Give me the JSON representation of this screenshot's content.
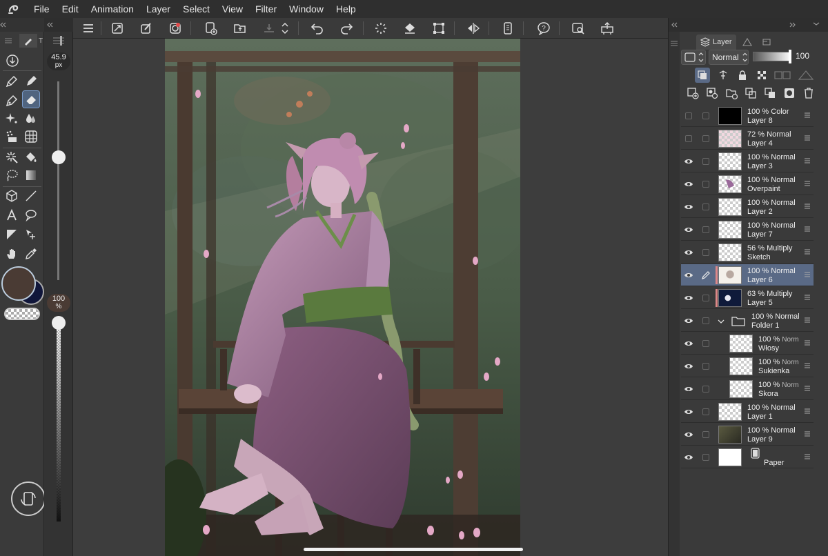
{
  "menu": [
    "File",
    "Edit",
    "Animation",
    "Layer",
    "Select",
    "View",
    "Filter",
    "Window",
    "Help"
  ],
  "brush": {
    "size_value": "45.9",
    "size_unit": "px",
    "opacity_value": "100",
    "opacity_unit": "%"
  },
  "colors": {
    "main": "#4a3b34",
    "sub": "#10163a",
    "accent": "#50647f"
  },
  "icons": {
    "app": "clip-studio-logo",
    "tools": [
      "save-icon",
      "pen-icon",
      "pencil-icon",
      "eraser-icon",
      "sparkle-icon",
      "blend-drop-icon",
      "fill-dots-icon",
      "grid-icon",
      "magic-wand-icon",
      "fill-bucket-icon",
      "lasso-icon",
      "gradient-icon",
      "3d-cube-icon",
      "line-icon",
      "text-icon",
      "speech-balloon-icon",
      "frame-ruler-icon",
      "object-select-icon",
      "hand-icon",
      "eyedropper-icon"
    ],
    "toolbar": [
      "hamburger-icon",
      "canvas-resize-icon",
      "brush-settings-icon",
      "color-wheel-icon",
      "new-file-icon",
      "open-folder-icon",
      "save-cloud-icon",
      "updown-icon",
      "undo-icon",
      "redo-icon",
      "loading-icon",
      "fill-icon",
      "transform-icon",
      "flip-icon",
      "smartphone-icon",
      "help-icon",
      "search-window-icon",
      "export-icon"
    ]
  },
  "layers_panel": {
    "tab_label": "Layer",
    "blend_mode": "Normal",
    "opacity": "100",
    "layers": [
      {
        "opacity": "100 %",
        "mode": "Color",
        "name": "Layer 8",
        "visible": false,
        "thumb": "black"
      },
      {
        "opacity": "72 %",
        "mode": "Normal",
        "name": "Layer 4",
        "visible": false,
        "thumb": "pinkish"
      },
      {
        "opacity": "100 %",
        "mode": "Normal",
        "name": "Layer 3",
        "visible": true,
        "thumb": "checker"
      },
      {
        "opacity": "100 %",
        "mode": "Normal",
        "name": "Overpaint",
        "visible": true,
        "thumb": "figure"
      },
      {
        "opacity": "100 %",
        "mode": "Normal",
        "name": "Layer 2",
        "visible": true,
        "thumb": "checker"
      },
      {
        "opacity": "100 %",
        "mode": "Normal",
        "name": "Layer 7",
        "visible": true,
        "thumb": "checker"
      },
      {
        "opacity": "56 %",
        "mode": "Multiply",
        "name": "Sketch",
        "visible": true,
        "thumb": "checker"
      },
      {
        "opacity": "100 %",
        "mode": "Normal",
        "name": "Layer 6",
        "visible": true,
        "thumb": "light-figure",
        "active": true
      },
      {
        "opacity": "63 %",
        "mode": "Multiply",
        "name": "Layer 5",
        "visible": true,
        "thumb": "navy"
      },
      {
        "opacity": "100 %",
        "mode": "Normal",
        "name": "Folder 1",
        "visible": true,
        "folder": true
      },
      {
        "opacity": "100 %",
        "mode": "Norm",
        "name": "Włosy",
        "visible": true,
        "thumb": "checker",
        "sub": true
      },
      {
        "opacity": "100 %",
        "mode": "Norm",
        "name": "Sukienka",
        "visible": true,
        "thumb": "checker",
        "sub": true
      },
      {
        "opacity": "100 %",
        "mode": "Norm",
        "name": "Skora",
        "visible": true,
        "thumb": "checker",
        "sub": true
      },
      {
        "opacity": "100 %",
        "mode": "Normal",
        "name": "Layer 1",
        "visible": true,
        "thumb": "checker"
      },
      {
        "opacity": "100 %",
        "mode": "Normal",
        "name": "Layer 9",
        "visible": true,
        "thumb": "dark-scene"
      },
      {
        "opacity": "",
        "mode": "",
        "name": "Paper",
        "visible": true,
        "thumb": "white",
        "paper": true
      }
    ]
  }
}
